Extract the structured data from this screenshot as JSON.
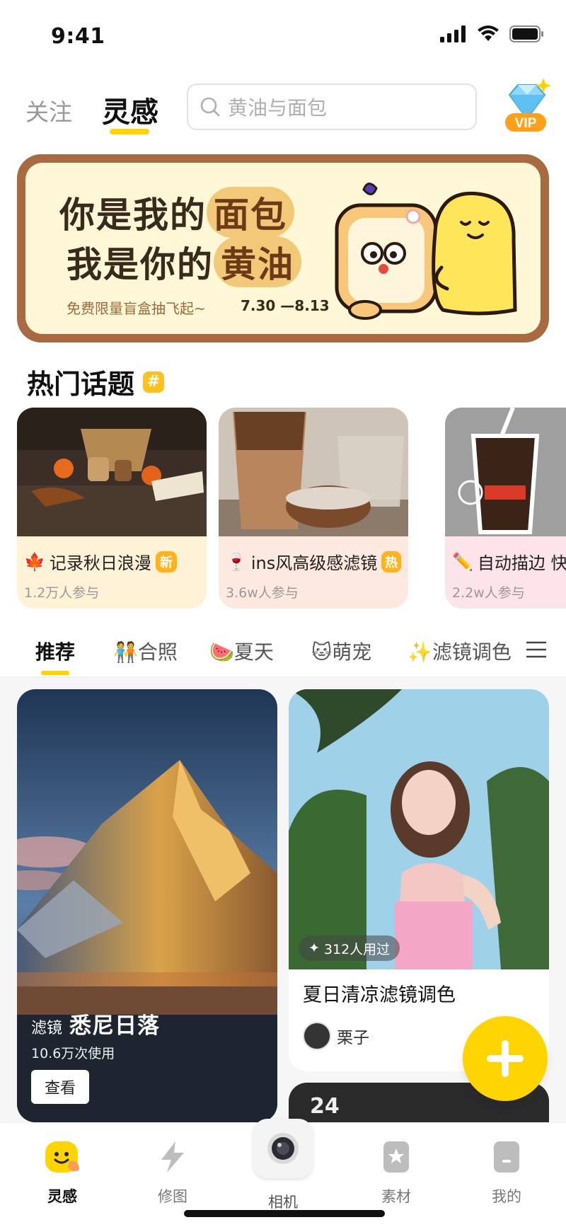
{
  "status": {
    "time": "9:41"
  },
  "header": {
    "tab_follow": "关注",
    "tab_inspire": "灵感",
    "search_placeholder": "黄油与面包",
    "vip_label": "VIP"
  },
  "banner": {
    "line1_a": "你是我的",
    "line1_b": "面包",
    "line2_a": "我是你的",
    "line2_b": "黄油",
    "subtitle": "免费限量盲盒抽飞起~",
    "date_range": "7.30 —8.13"
  },
  "hot_topics": {
    "title": "热门话题",
    "badge": "#",
    "items": [
      {
        "emoji": "🍁",
        "title": "记录秋日浪漫",
        "tag": "新",
        "count": "1.2万人参与",
        "bg": "#fff2d6"
      },
      {
        "emoji": "🍷",
        "title": "ins风高级感滤镜",
        "tag": "热",
        "count": "3.6w人参与",
        "bg": "#fde9df"
      },
      {
        "emoji": "✏️",
        "title": "自动描边 快",
        "tag": "",
        "count": "2.2w人参与",
        "bg": "#fde3ea"
      }
    ]
  },
  "categories": {
    "items": [
      {
        "label": "推荐",
        "active": true
      },
      {
        "label": "🧑‍🤝‍🧑合照",
        "active": false
      },
      {
        "label": "🍉夏天",
        "active": false
      },
      {
        "label": "🐱萌宠",
        "active": false
      },
      {
        "label": "✨滤镜调色",
        "active": false
      }
    ]
  },
  "feed": {
    "left": {
      "kind": "滤镜",
      "name": "悉尼日落",
      "usage": "10.6万次使用",
      "button": "查看"
    },
    "right": {
      "used": "312人用过",
      "title": "夏日清凉滤镜调色",
      "author": "栗子"
    },
    "right2": {
      "day": "24"
    }
  },
  "bottom_nav": {
    "items": [
      {
        "label": "灵感",
        "active": true
      },
      {
        "label": "修图",
        "active": false
      },
      {
        "label": "相机",
        "active": false
      },
      {
        "label": "素材",
        "active": false
      },
      {
        "label": "我的",
        "active": false
      }
    ]
  },
  "colors": {
    "accent": "#ffd400",
    "tag": "#ffb21a",
    "banner_border": "#a86a40"
  }
}
